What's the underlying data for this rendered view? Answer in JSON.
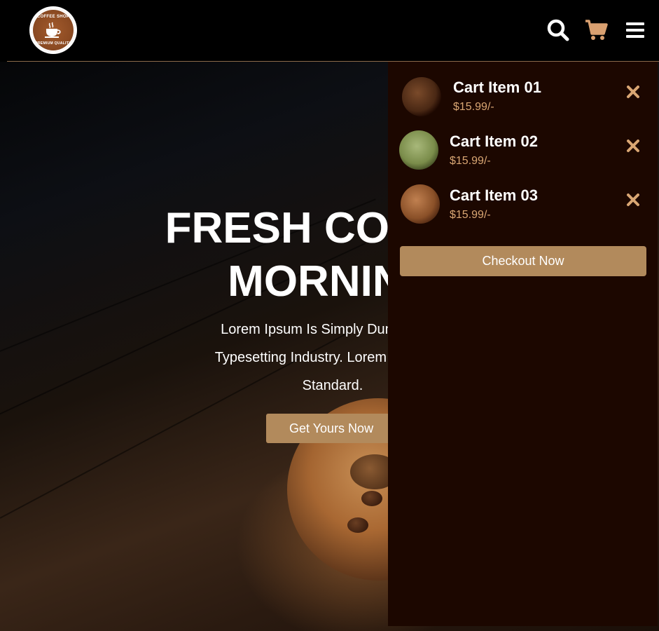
{
  "header": {
    "logo": {
      "top_text": "COFFEE SHOP",
      "bottom_text": "PREMIUM QUALITY"
    },
    "icons": [
      "search-icon",
      "cart-icon",
      "menu-icon"
    ]
  },
  "hero": {
    "title_line1": "FRESH COFFEE",
    "title_line2": "MORNING",
    "text_line1": "Lorem Ipsum Is Simply Dummy Text",
    "text_line2": "Typesetting Industry. Lorem Ipsum Ha",
    "text_line3": "Standard.",
    "button_label": "Get Yours Now"
  },
  "cart": {
    "items": [
      {
        "title": "Cart Item 01",
        "price": "$15.99/-"
      },
      {
        "title": "Cart Item 02",
        "price": "$15.99/-"
      },
      {
        "title": "Cart Item 03",
        "price": "$15.99/-"
      }
    ],
    "checkout_label": "Checkout Now"
  },
  "colors": {
    "accent": "#b28a5c",
    "panel_bg": "#1c0700",
    "price": "#d9a673",
    "cart_icon": "#d9a070"
  }
}
